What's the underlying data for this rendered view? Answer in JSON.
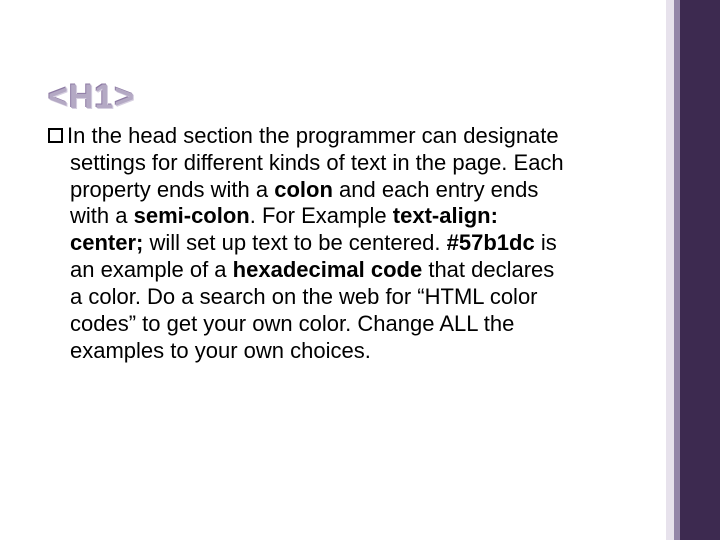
{
  "heading": "<H1>",
  "body": {
    "t1": "In the head section the programmer can designate settings for different kinds of text in the page.  Each property ends with a ",
    "b1": "colon",
    "t2": " and each entry ends with a ",
    "b2": "semi-colon",
    "t3": ".  For Example ",
    "b3": "text-align: center;",
    "t4": " will set up text to be centered.  ",
    "b4": "#57b1dc",
    "t5": " is an example of a ",
    "b5": "hexadecimal code",
    "t6": " that declares a color.  Do a search on the web for “HTML color codes” to get your own color.  Change ALL the examples to your own choices."
  }
}
